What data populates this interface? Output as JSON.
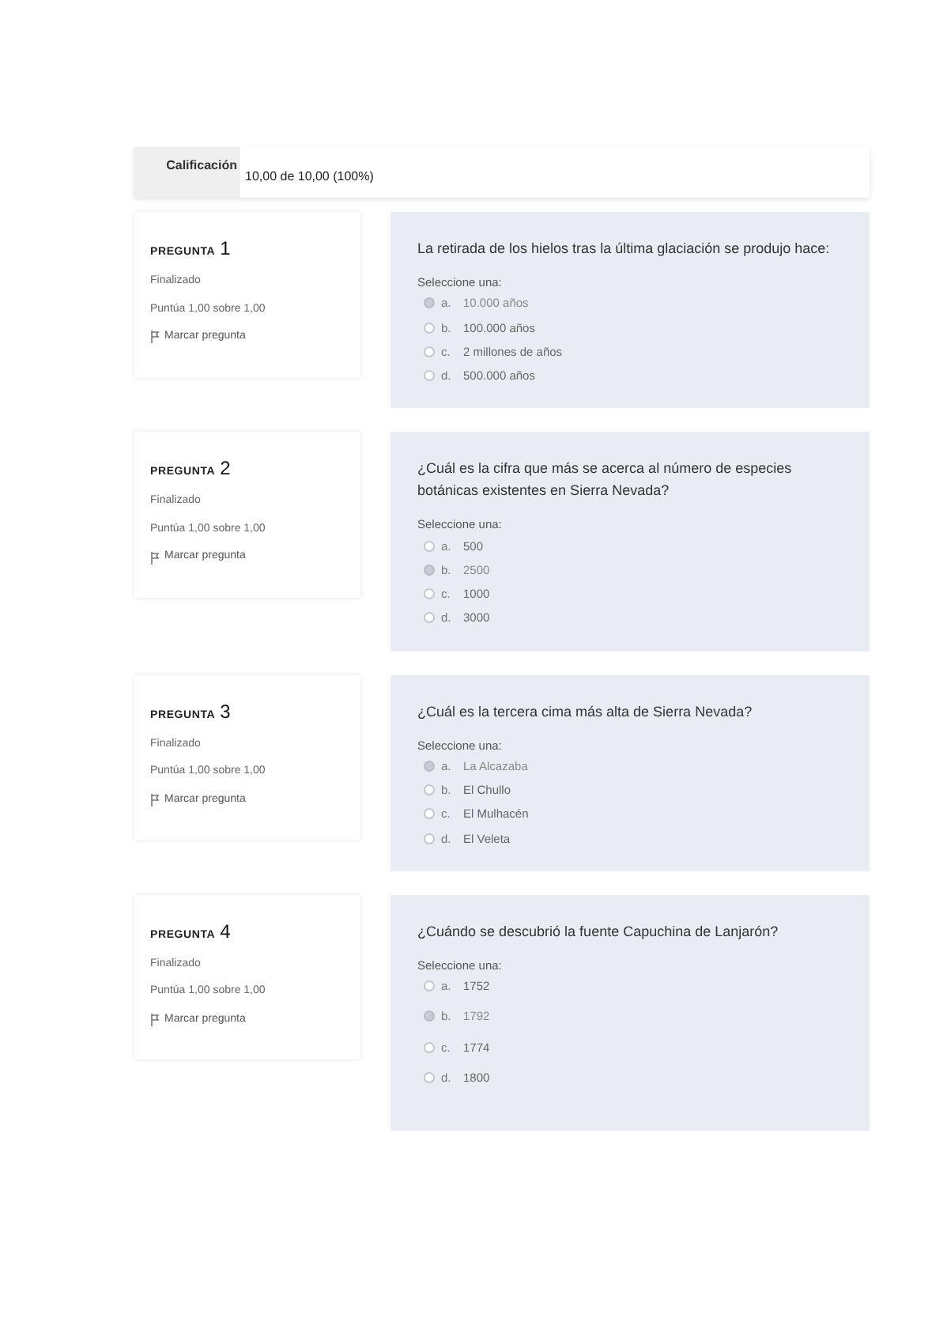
{
  "grade": {
    "label": "Calificación",
    "value": "10,00 de 10,00 (100%)"
  },
  "questions": [
    {
      "heading": "PREGUNTA",
      "number": "1",
      "status": "Finalizado",
      "score": "Puntúa 1,00 sobre 1,00",
      "flag": "Marcar pregunta",
      "text": "La retirada de los hielos tras la última glaciación se produjo hace:",
      "prompt": "Seleccione una:",
      "options": [
        {
          "letter": "a.",
          "text": "10.000 años",
          "selected": true
        },
        {
          "letter": "b.",
          "text": "100.000 años",
          "selected": false
        },
        {
          "letter": "c.",
          "text": "2 millones de años",
          "selected": false
        },
        {
          "letter": "d.",
          "text": "500.000 años",
          "selected": false
        }
      ]
    },
    {
      "heading": "PREGUNTA",
      "number": "2",
      "status": "Finalizado",
      "score": "Puntúa 1,00 sobre 1,00",
      "flag": "Marcar pregunta",
      "text": "¿Cuál es la cifra que más se acerca al número de especies botánicas existentes en Sierra Nevada?",
      "prompt": "Seleccione una:",
      "options": [
        {
          "letter": "a.",
          "text": "500",
          "selected": false
        },
        {
          "letter": "b.",
          "text": "2500",
          "selected": true
        },
        {
          "letter": "c.",
          "text": "1000",
          "selected": false
        },
        {
          "letter": "d.",
          "text": "3000",
          "selected": false
        }
      ]
    },
    {
      "heading": "PREGUNTA",
      "number": "3",
      "status": "Finalizado",
      "score": "Puntúa 1,00 sobre 1,00",
      "flag": "Marcar pregunta",
      "text": "¿Cuál es la tercera cima más alta de Sierra Nevada?",
      "prompt": "Seleccione una:",
      "options": [
        {
          "letter": "a.",
          "text": "La Alcazaba",
          "selected": true
        },
        {
          "letter": "b.",
          "text": "El Chullo",
          "selected": false
        },
        {
          "letter": "c.",
          "text": "El Mulhacén",
          "selected": false
        },
        {
          "letter": "d.",
          "text": "El Veleta",
          "selected": false
        }
      ]
    },
    {
      "heading": "PREGUNTA",
      "number": "4",
      "status": "Finalizado",
      "score": "Puntúa 1,00 sobre 1,00",
      "flag": "Marcar pregunta",
      "text": "¿Cuándo se descubrió la fuente Capuchina de Lanjarón?",
      "prompt": "Seleccione una:",
      "options": [
        {
          "letter": "a.",
          "text": "1752",
          "selected": false
        },
        {
          "letter": "b.",
          "text": "1792",
          "selected": true
        },
        {
          "letter": "c.",
          "text": "1774",
          "selected": false
        },
        {
          "letter": "d.",
          "text": "1800",
          "selected": false
        }
      ]
    }
  ]
}
